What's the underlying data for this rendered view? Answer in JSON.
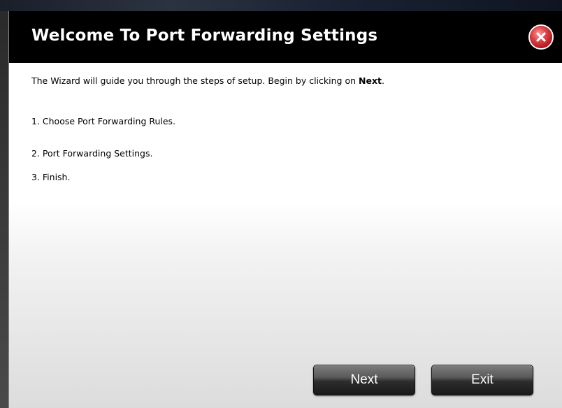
{
  "dialog": {
    "title": "Welcome To Port Forwarding Settings",
    "close_icon": "close-icon",
    "intro_text": "The Wizard will guide you through the steps of setup. Begin by clicking on ",
    "intro_bold": "Next",
    "intro_end": ".",
    "steps": [
      "1. Choose Port Forwarding Rules.",
      "2. Port Forwarding Settings.",
      "3. Finish."
    ],
    "buttons": {
      "next": "Next",
      "exit": "Exit"
    }
  },
  "colors": {
    "titlebar": "#000000",
    "close_button": "#d0262b",
    "button": "#3a3a3a"
  }
}
